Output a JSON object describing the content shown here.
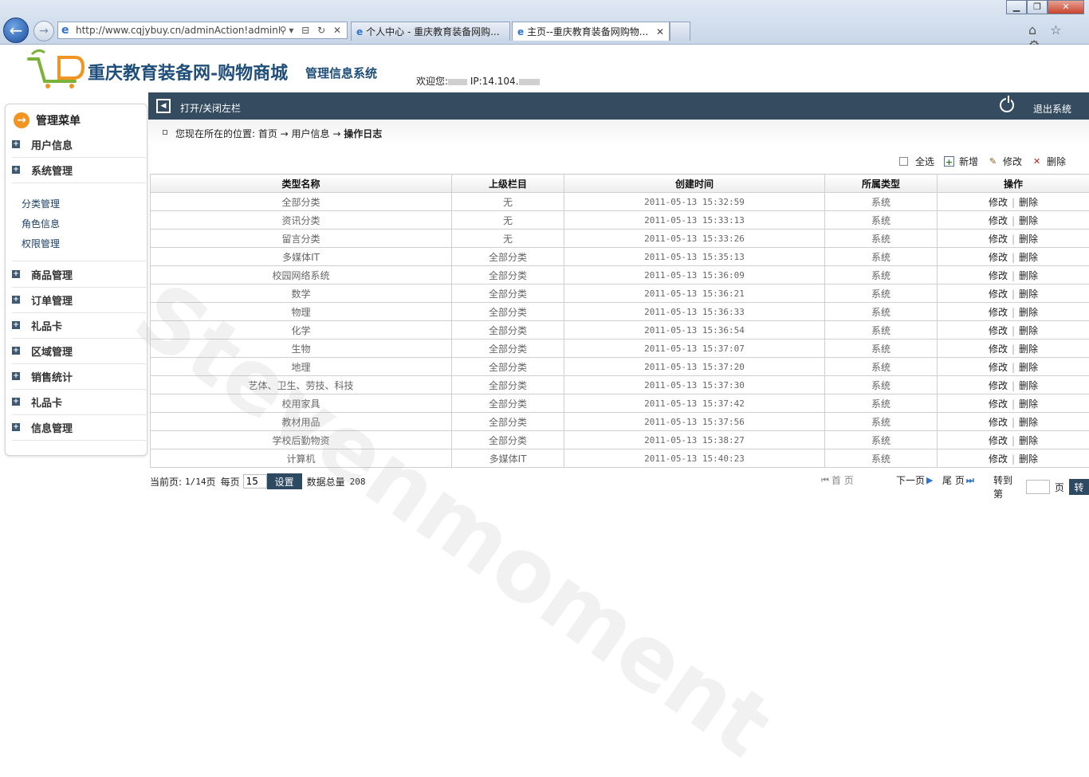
{
  "browser": {
    "url": "http://www.cqjybuy.cn/adminAction!adminLc",
    "tabs": [
      {
        "label": "个人中心 - 重庆教育装备网购..."
      },
      {
        "label": "主页--重庆教育装备网购物..."
      }
    ],
    "win_min": "▁",
    "win_max": "❐",
    "win_close": "✕",
    "addr_tools": "⚲▾ ⊟ ↻ ✕",
    "tab_close": "✕",
    "tools": "⌂ ☆ ⚙"
  },
  "header": {
    "site_title": "重庆教育装备网-购物商城",
    "site_subtitle": "管理信息系统",
    "welcome_label": "欢迎您:",
    "ip_label": "IP:14.104."
  },
  "toolbar": {
    "toggle_label": "打开/关闭左栏",
    "logout_label": "退出系统"
  },
  "sidebar": {
    "title": "管理菜单",
    "items": [
      {
        "label": "用户信息"
      },
      {
        "label": "系统管理"
      },
      {
        "label": "商品管理"
      },
      {
        "label": "订单管理"
      },
      {
        "label": "礼品卡"
      },
      {
        "label": "区域管理"
      },
      {
        "label": "销售统计"
      },
      {
        "label": "礼品卡"
      },
      {
        "label": "信息管理"
      }
    ],
    "sub_items": [
      {
        "label": "分类管理"
      },
      {
        "label": "角色信息"
      },
      {
        "label": "权限管理"
      }
    ]
  },
  "breadcrumb": {
    "prefix": "您现在所在的位置: 首页 → 用户信息 → ",
    "current": "操作日志"
  },
  "actions": {
    "select_all": "全选",
    "add": "新增",
    "edit": "修改",
    "delete": "删除"
  },
  "table": {
    "columns": [
      "类型名称",
      "上级栏目",
      "创建时间",
      "所属类型",
      "操作"
    ],
    "op_edit": "修改",
    "op_delete": "删除",
    "rows": [
      {
        "name": "全部分类",
        "parent": "无",
        "created": "2011-05-13 15:32:59",
        "type": "系统"
      },
      {
        "name": "资讯分类",
        "parent": "无",
        "created": "2011-05-13 15:33:13",
        "type": "系统"
      },
      {
        "name": "留言分类",
        "parent": "无",
        "created": "2011-05-13 15:33:26",
        "type": "系统"
      },
      {
        "name": "多媒体IT",
        "parent": "全部分类",
        "created": "2011-05-13 15:35:13",
        "type": "系统"
      },
      {
        "name": "校园网络系统",
        "parent": "全部分类",
        "created": "2011-05-13 15:36:09",
        "type": "系统"
      },
      {
        "name": "数学",
        "parent": "全部分类",
        "created": "2011-05-13 15:36:21",
        "type": "系统"
      },
      {
        "name": "物理",
        "parent": "全部分类",
        "created": "2011-05-13 15:36:33",
        "type": "系统"
      },
      {
        "name": "化学",
        "parent": "全部分类",
        "created": "2011-05-13 15:36:54",
        "type": "系统"
      },
      {
        "name": "生物",
        "parent": "全部分类",
        "created": "2011-05-13 15:37:07",
        "type": "系统"
      },
      {
        "name": "地理",
        "parent": "全部分类",
        "created": "2011-05-13 15:37:20",
        "type": "系统"
      },
      {
        "name": "艺体、卫生、劳技、科技",
        "parent": "全部分类",
        "created": "2011-05-13 15:37:30",
        "type": "系统"
      },
      {
        "name": "校用家具",
        "parent": "全部分类",
        "created": "2011-05-13 15:37:42",
        "type": "系统"
      },
      {
        "name": "教材用品",
        "parent": "全部分类",
        "created": "2011-05-13 15:37:56",
        "type": "系统"
      },
      {
        "name": "学校后勤物资",
        "parent": "全部分类",
        "created": "2011-05-13 15:38:27",
        "type": "系统"
      },
      {
        "name": "计算机",
        "parent": "多媒体IT",
        "created": "2011-05-13 15:40:23",
        "type": "系统"
      }
    ]
  },
  "pager": {
    "current_label": "当前页:",
    "current_value": "1/14",
    "page_unit": "页",
    "per_page_label": "每页",
    "per_page_value": "15",
    "set_label": "设置",
    "total_label": "数据总量",
    "total_value": "208",
    "first_label": "首 页",
    "next_label": "下一页",
    "last_label": "尾 页",
    "goto_label": "转到第",
    "goto_unit": "页",
    "go_label": "转"
  },
  "watermark": "Stevenmoment",
  "colors": {
    "toolbar_bg": "#344b60",
    "accent_orange": "#f29422",
    "title_blue": "#1f4e7a"
  }
}
